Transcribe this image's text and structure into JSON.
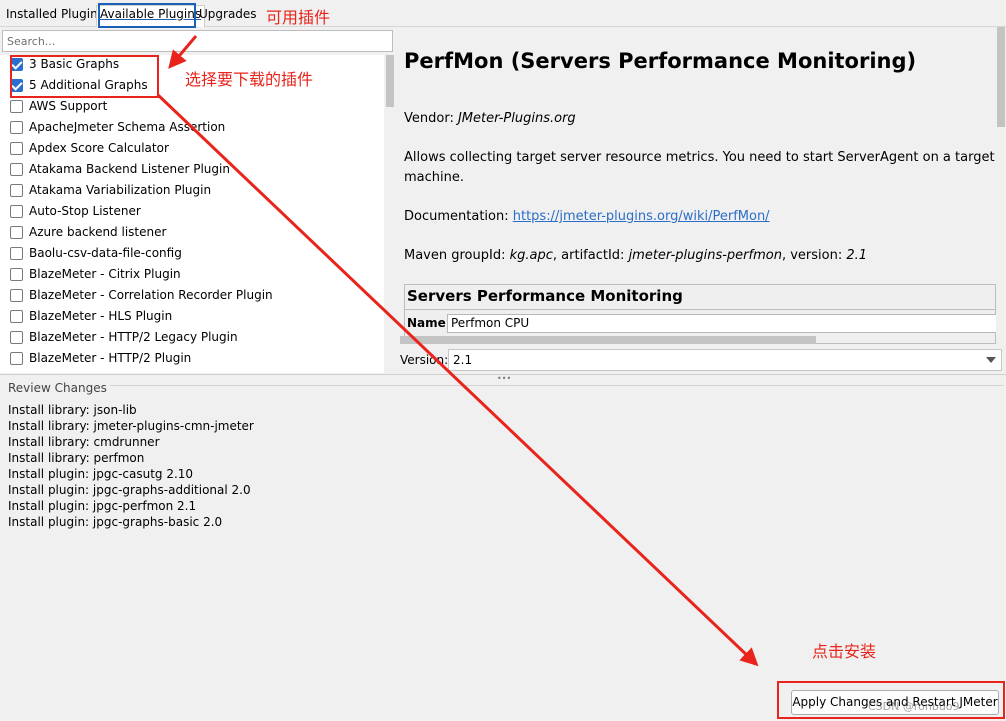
{
  "tabs": {
    "installed": "Installed Plugins",
    "available": "Available Plugins",
    "upgrades": "Upgrades"
  },
  "search": {
    "placeholder": "Search..."
  },
  "plugins": [
    {
      "label": "3 Basic Graphs",
      "checked": true
    },
    {
      "label": "5 Additional Graphs",
      "checked": true
    },
    {
      "label": "AWS Support",
      "checked": false
    },
    {
      "label": "ApacheJmeter Schema Assertion",
      "checked": false
    },
    {
      "label": "Apdex Score Calculator",
      "checked": false
    },
    {
      "label": "Atakama Backend Listener Plugin",
      "checked": false
    },
    {
      "label": "Atakama Variabilization Plugin",
      "checked": false
    },
    {
      "label": "Auto-Stop Listener",
      "checked": false
    },
    {
      "label": "Azure backend listener",
      "checked": false
    },
    {
      "label": "Baolu-csv-data-file-config",
      "checked": false
    },
    {
      "label": "BlazeMeter - Citrix Plugin",
      "checked": false
    },
    {
      "label": "BlazeMeter - Correlation Recorder Plugin",
      "checked": false
    },
    {
      "label": "BlazeMeter - HLS Plugin",
      "checked": false
    },
    {
      "label": "BlazeMeter - HTTP/2 Legacy Plugin",
      "checked": false
    },
    {
      "label": "BlazeMeter - HTTP/2 Plugin",
      "checked": false
    }
  ],
  "details": {
    "title": "PerfMon (Servers Performance Monitoring)",
    "vendor_label": "Vendor: ",
    "vendor": "JMeter-Plugins.org",
    "description_1": "Allows collecting target server resource metrics. You need to start ServerAgent on a target",
    "description_2": "machine.",
    "doc_label": "Documentation: ",
    "doc_link": "https://jmeter-plugins.org/wiki/PerfMon/",
    "maven_label": "Maven groupId: ",
    "maven_group": "kg.apc",
    "artifact_label": ", artifactId: ",
    "artifact": "jmeter-plugins-perfmon",
    "version_label_inline": ", version: ",
    "version_inline": "2.1",
    "table_header": "Servers Performance Monitoring",
    "name_label": "Name:",
    "name_value": "Perfmon CPU"
  },
  "version": {
    "label": "Version:",
    "value": "2.1"
  },
  "splitter_dots": "•••",
  "review": {
    "title": "Review Changes",
    "items": [
      "Install library: json-lib",
      "Install library: jmeter-plugins-cmn-jmeter",
      "Install library: cmdrunner",
      "Install library: perfmon",
      "Install plugin: jpgc-casutg 2.10",
      "Install plugin: jpgc-graphs-additional 2.0",
      "Install plugin: jpgc-perfmon 2.1",
      "Install plugin: jpgc-graphs-basic 2.0"
    ]
  },
  "apply_button": "Apply Changes and Restart JMeter",
  "watermark": "CSDN @ronbuo9",
  "annotations": {
    "available": "可用插件",
    "select": "选择要下载的插件",
    "install": "点击安装",
    "color": "#e8241c"
  }
}
